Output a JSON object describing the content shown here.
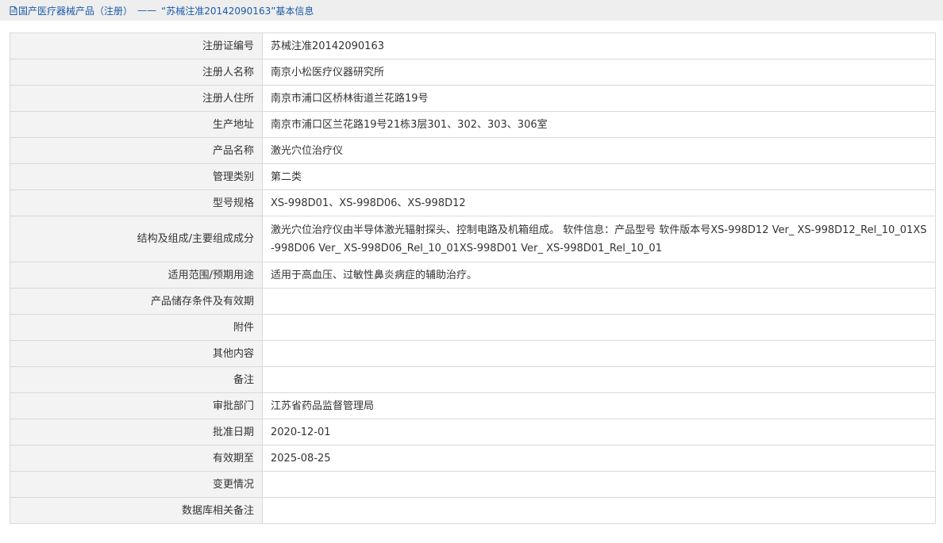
{
  "breadcrumb": {
    "section": "国产医疗器械产品（注册）",
    "separator": "——",
    "title": "“苏械注准20142090163”基本信息"
  },
  "fields": [
    {
      "label": "注册证编号",
      "value": "苏械注准20142090163"
    },
    {
      "label": "注册人名称",
      "value": "南京小松医疗仪器研究所"
    },
    {
      "label": "注册人住所",
      "value": "南京市浦口区桥林街道兰花路19号"
    },
    {
      "label": "生产地址",
      "value": "南京市浦口区兰花路19号21栋3层301、302、303、306室"
    },
    {
      "label": "产品名称",
      "value": "激光穴位治疗仪"
    },
    {
      "label": "管理类别",
      "value": "第二类"
    },
    {
      "label": "型号规格",
      "value": "XS-998D01、XS-998D06、XS-998D12"
    },
    {
      "label": "结构及组成/主要组成成分",
      "value": "激光穴位治疗仪由半导体激光辐射探头、控制电路及机箱组成。 软件信息：产品型号 软件版本号XS-998D12 Ver_ XS-998D12_Rel_10_01XS-998D06 Ver_ XS-998D06_Rel_10_01XS-998D01 Ver_ XS-998D01_Rel_10_01"
    },
    {
      "label": "适用范围/预期用途",
      "value": "适用于高血压、过敏性鼻炎病症的辅助治疗。"
    },
    {
      "label": "产品储存条件及有效期",
      "value": ""
    },
    {
      "label": "附件",
      "value": ""
    },
    {
      "label": "其他内容",
      "value": ""
    },
    {
      "label": "备注",
      "value": ""
    },
    {
      "label": "审批部门",
      "value": "江苏省药品监督管理局"
    },
    {
      "label": "批准日期",
      "value": "2020-12-01"
    },
    {
      "label": "有效期至",
      "value": "2025-08-25"
    },
    {
      "label": "变更情况",
      "value": ""
    },
    {
      "label": "数据库相关备注",
      "value": ""
    }
  ],
  "colors": {
    "header_bg": "#eeeeee",
    "header_text": "#1b5ba8",
    "label_bg": "#f3f3f3",
    "border": "#d9d9d9"
  },
  "icons": {
    "breadcrumb": "document-icon"
  }
}
